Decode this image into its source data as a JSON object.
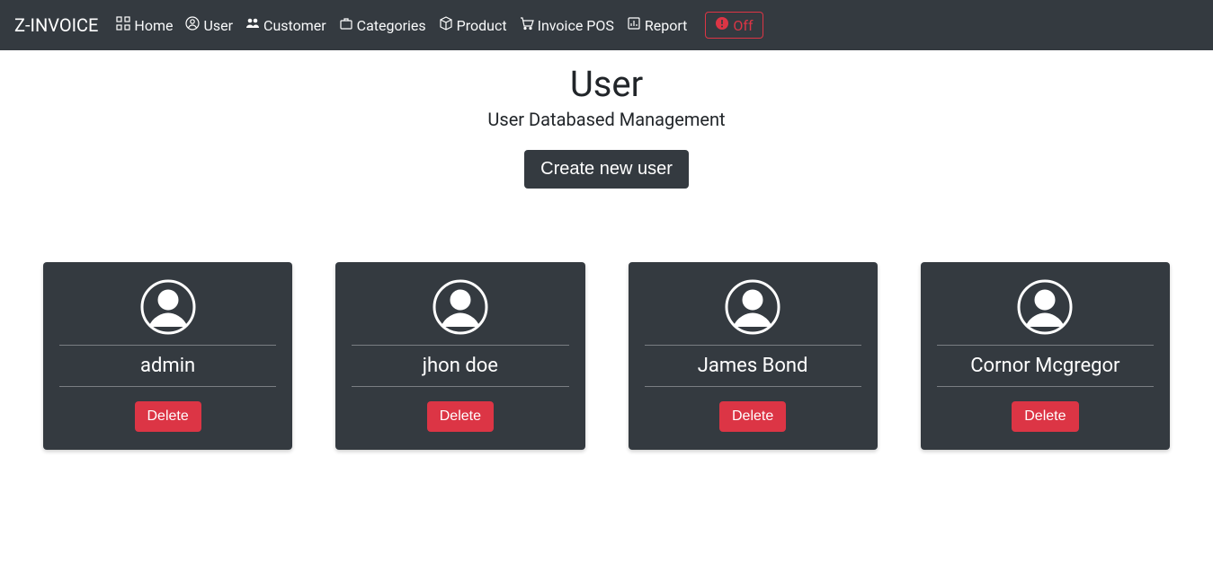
{
  "brand": "Z-INVOICE",
  "nav": {
    "home": "Home",
    "user": "User",
    "customer": "Customer",
    "categories": "Categories",
    "product": "Product",
    "invoice_pos": "Invoice POS",
    "report": "Report",
    "off": "Off"
  },
  "page": {
    "title": "User",
    "subtitle": "User Databased Management",
    "create_label": "Create new user"
  },
  "users": [
    {
      "name": "admin",
      "delete_label": "Delete"
    },
    {
      "name": "jhon doe",
      "delete_label": "Delete"
    },
    {
      "name": "James Bond",
      "delete_label": "Delete"
    },
    {
      "name": "Cornor Mcgregor",
      "delete_label": "Delete"
    }
  ]
}
